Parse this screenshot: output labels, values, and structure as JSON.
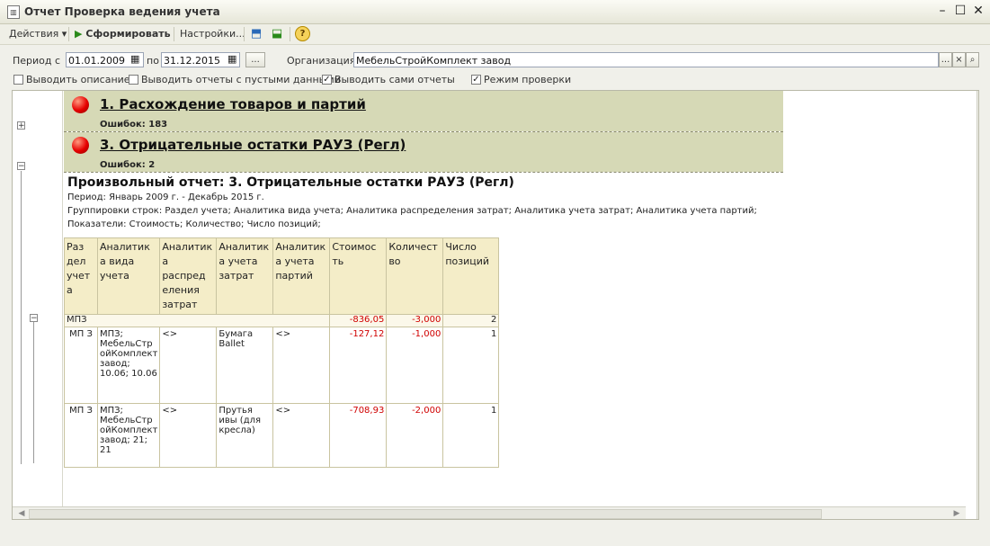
{
  "window": {
    "title": "Отчет  Проверка ведения учета"
  },
  "toolbar": {
    "actions": "Действия",
    "generate": "Сформировать",
    "settings": "Настройки..."
  },
  "filters": {
    "period_from_label": "Период с",
    "period_from": "01.01.2009",
    "period_to_label": "по",
    "period_to": "31.12.2015",
    "more_button": "...",
    "org_label": "Организация:",
    "org_value": "МебельСтройКомплект завод",
    "org_select": "...",
    "org_clear": "×"
  },
  "options": [
    {
      "label": "Выводить описание",
      "checked": false
    },
    {
      "label": "Выводить отчеты с пустыми данными",
      "checked": false
    },
    {
      "label": "Выводить сами отчеты",
      "checked": true
    },
    {
      "label": "Режим проверки",
      "checked": true
    }
  ],
  "groups": [
    {
      "title": "1. Расхождение товаров и партий",
      "errors": "Ошибок: 183",
      "collapsed": true
    },
    {
      "title": "3. Отрицательные остатки РАУЗ (Регл)",
      "errors": "Ошибок: 2",
      "collapsed": false
    }
  ],
  "report": {
    "title": "Произвольный отчет: 3. Отрицательные остатки РАУЗ (Регл)",
    "period": "Период: Январь 2009 г. - Декабрь 2015 г.",
    "groupings": "Группировки строк: Раздел учета; Аналитика вида учета; Аналитика распределения затрат; Аналитика учета затрат; Аналитика учета партий;",
    "indicators": "Показатели: Стоимость; Количество; Число позиций;",
    "headers": [
      "Раз дел учет а",
      "Аналитик а вида учета",
      "Аналитик а распред еления затрат",
      "Аналитик а учета затрат",
      "Аналитик а учета партий",
      "Стоимос ть",
      "Количест во",
      "Число позиций"
    ],
    "group_row": {
      "section": "МПЗ",
      "cost": "-836,05",
      "qty": "-3,000",
      "count": "2"
    },
    "rows": [
      {
        "section": "МП З",
        "kind": "МПЗ; МебельСтр ойКомплект завод; 10.06; 10.06",
        "distr": "<>",
        "cost_acc": "Бумага Ballet",
        "batch": "<>",
        "cost": "-127,12",
        "qty": "-1,000",
        "count": "1"
      },
      {
        "section": "МП З",
        "kind": "МПЗ; МебельСтр ойКомплект завод; 21; 21",
        "distr": "<>",
        "cost_acc": "Прутья ивы (для кресла)",
        "batch": "<>",
        "cost": "-708,93",
        "qty": "-2,000",
        "count": "1"
      }
    ]
  }
}
